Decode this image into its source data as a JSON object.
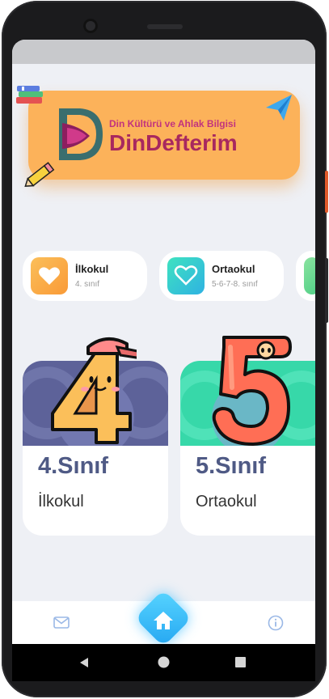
{
  "banner": {
    "subtitle": "Din Kültürü ve Ahlak Bilgisi",
    "title": "DinDefterim",
    "colors": {
      "background": "#fcb25a",
      "subtitle": "#c2337e",
      "title": "#a8285f"
    }
  },
  "levels": [
    {
      "title": "İlkokul",
      "subtitle": "4. sınıf",
      "icon": "heart-icon",
      "color": "#fba03f"
    },
    {
      "title": "Ortaokul",
      "subtitle": "5-6-7-8. sınıf",
      "icon": "heart-outline-icon",
      "color": "#30c7d8"
    }
  ],
  "grades": [
    {
      "grade": "4.Sınıf",
      "level": "İlkokul",
      "mascot": "number-four-mascot",
      "color": "#5d6299"
    },
    {
      "grade": "5.Sınıf",
      "level": "Ortaokul",
      "mascot": "number-five-mascot",
      "color": "#37d8a9"
    }
  ],
  "bottom_nav": {
    "items": [
      "mail-icon",
      "home-icon",
      "info-icon"
    ],
    "accent": "#25a7f2"
  }
}
